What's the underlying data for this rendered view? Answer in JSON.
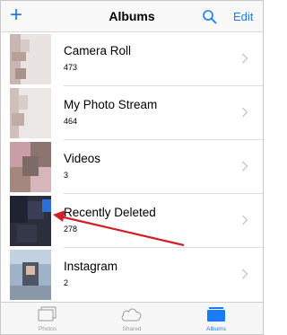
{
  "nav": {
    "title": "Albums",
    "edit_label": "Edit",
    "add_icon": "plus-icon",
    "search_icon": "search-icon"
  },
  "albums": [
    {
      "name": "Camera Roll",
      "count": "473"
    },
    {
      "name": "My Photo Stream",
      "count": "464"
    },
    {
      "name": "Videos",
      "count": "3"
    },
    {
      "name": "Recently Deleted",
      "count": "278"
    },
    {
      "name": "Instagram",
      "count": "2"
    }
  ],
  "tabs": [
    {
      "label": "Photos",
      "icon": "photos-icon",
      "active": false
    },
    {
      "label": "Shared",
      "icon": "cloud-icon",
      "active": false
    },
    {
      "label": "Albums",
      "icon": "albums-icon",
      "active": true
    }
  ],
  "colors": {
    "accent": "#1a7bf2",
    "annotation_arrow": "#d0202a"
  }
}
